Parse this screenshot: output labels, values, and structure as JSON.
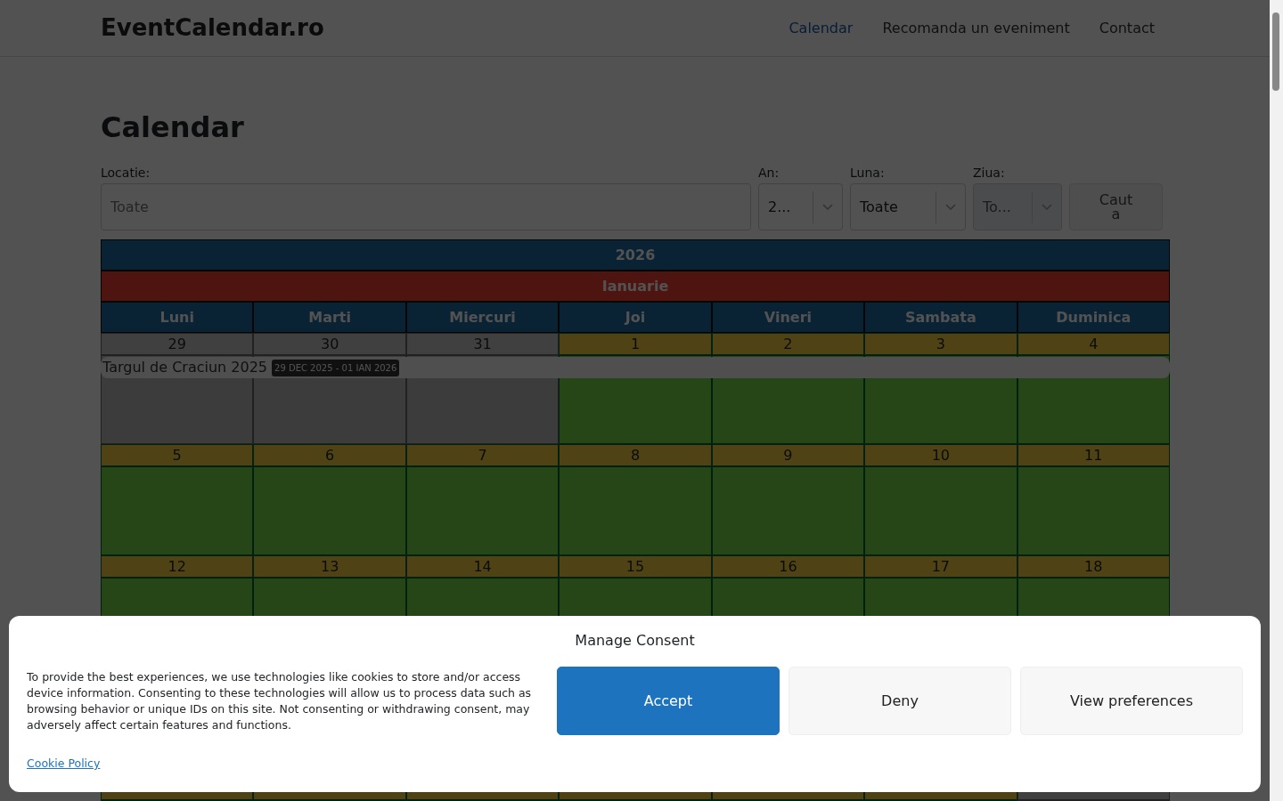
{
  "navbar": {
    "brand": "EventCalendar.ro",
    "links": [
      {
        "label": "Calendar",
        "selected": true
      },
      {
        "label": "Recomanda un eveniment",
        "selected": false
      },
      {
        "label": "Contact",
        "selected": false
      }
    ]
  },
  "page_title": "Calendar",
  "filters": {
    "location": {
      "label": "Locatie:",
      "placeholder": "Toate"
    },
    "selects": [
      {
        "label": "An:",
        "value": "2...",
        "disabled": false
      },
      {
        "label": "Luna:",
        "value": "Toate",
        "disabled": false
      },
      {
        "label": "Ziua:",
        "value": "To...",
        "disabled": true
      }
    ],
    "search_button": {
      "label": "Cauta",
      "disabled": true
    }
  },
  "calendar": {
    "year": "2026",
    "month": "Ianuarie",
    "weekdays": [
      "Luni",
      "Marti",
      "Miercuri",
      "Joi",
      "Vineri",
      "Sambata",
      "Duminica"
    ],
    "weeks": [
      {
        "days": [
          {
            "day": "29",
            "kind": "other"
          },
          {
            "day": "30",
            "kind": "other"
          },
          {
            "day": "31",
            "kind": "other"
          },
          {
            "day": "1",
            "kind": "current"
          },
          {
            "day": "2",
            "kind": "current"
          },
          {
            "day": "3",
            "kind": "current"
          },
          {
            "day": "4",
            "kind": "current"
          }
        ],
        "events": [
          {
            "title": "Targul de Craciun 2025",
            "dates": "29 DEC 2025 - 01 IAN 2026"
          }
        ]
      },
      {
        "days": [
          {
            "day": "5",
            "kind": "current"
          },
          {
            "day": "6",
            "kind": "current"
          },
          {
            "day": "7",
            "kind": "current"
          },
          {
            "day": "8",
            "kind": "current"
          },
          {
            "day": "9",
            "kind": "current"
          },
          {
            "day": "10",
            "kind": "current"
          },
          {
            "day": "11",
            "kind": "current"
          }
        ]
      },
      {
        "days": [
          {
            "day": "12",
            "kind": "current"
          },
          {
            "day": "13",
            "kind": "current"
          },
          {
            "day": "14",
            "kind": "current"
          },
          {
            "day": "15",
            "kind": "current"
          },
          {
            "day": "16",
            "kind": "current"
          },
          {
            "day": "17",
            "kind": "current"
          },
          {
            "day": "18",
            "kind": "current"
          }
        ]
      },
      {
        "days": [
          {
            "kind": "current"
          },
          {
            "kind": "current"
          },
          {
            "kind": "current"
          },
          {
            "kind": "current"
          },
          {
            "kind": "current"
          },
          {
            "kind": "current"
          },
          {
            "kind": "other"
          }
        ]
      }
    ]
  },
  "consent": {
    "title": "Manage Consent",
    "text": "To provide the best experiences, we use technologies like cookies to store and/or access device information. Consenting to these technologies will allow us to process data such as browsing behavior or unique IDs on this site. Not consenting or withdrawing consent, may adversely affect certain features and functions.",
    "buttons": [
      {
        "label": "Accept",
        "kind": "primary"
      },
      {
        "label": "Deny",
        "kind": "secondary"
      },
      {
        "label": "View preferences",
        "kind": "secondary"
      }
    ],
    "link": "Cookie Policy"
  }
}
